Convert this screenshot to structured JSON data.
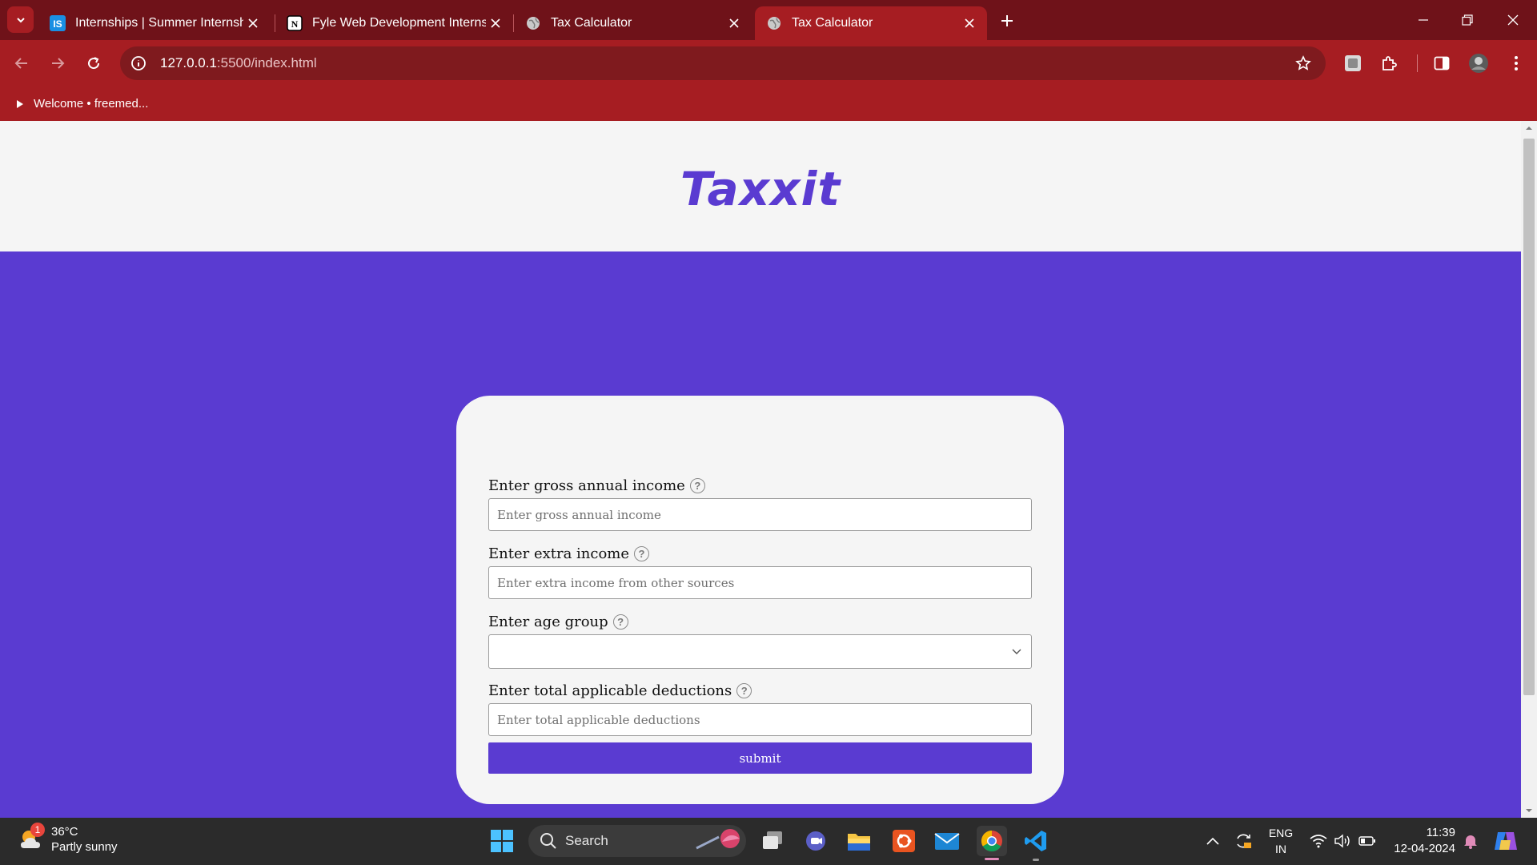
{
  "browser": {
    "tabs": [
      {
        "title": "Internships | Summer Internship",
        "favicon": "internshala-icon",
        "active": false
      },
      {
        "title": "Fyle Web Development Internsh",
        "favicon": "notion-icon",
        "active": false
      },
      {
        "title": "Tax Calculator",
        "favicon": "globe-icon",
        "active": false
      },
      {
        "title": "Tax Calculator",
        "favicon": "globe-icon",
        "active": true
      }
    ],
    "url_host": "127.0.0.1",
    "url_path": ":5500/index.html",
    "bookmark": "Welcome • freemed..."
  },
  "page": {
    "brand": "Taxxit",
    "form": {
      "gross_label": "Enter gross annual income",
      "gross_placeholder": "Enter gross annual income",
      "extra_label": "Enter extra income",
      "extra_placeholder": "Enter extra income from other sources",
      "age_label": "Enter age group",
      "age_value": "",
      "deductions_label": "Enter total applicable deductions",
      "deductions_placeholder": "Enter total applicable deductions",
      "submit_label": "submit"
    }
  },
  "taskbar": {
    "weather_temp": "36°C",
    "weather_desc": "Partly sunny",
    "weather_badge": "1",
    "search_label": "Search",
    "lang_line1": "ENG",
    "lang_line2": "IN",
    "time": "11:39",
    "date": "12-04-2024"
  },
  "colors": {
    "brand_purple": "#5a3bd1",
    "chrome_dark": "#6f1219",
    "chrome_red": "#a61d22",
    "card_bg": "#f5f5f5"
  }
}
